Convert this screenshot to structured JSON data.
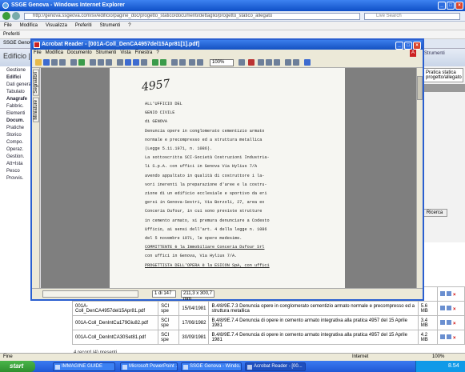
{
  "ie": {
    "title": "SSGE Genova - Windows Internet Explorer",
    "url": "http://genova.ssgeova.com/sv/edificio/pagine_doc/progetto_statico/documenti/dettaglio/progetto_statico_allegato",
    "search_placeholder": "Live Search",
    "menu": [
      "File",
      "Modifica",
      "Visualizza",
      "Preferiti",
      "Strumenti",
      "?"
    ],
    "favorites_label": "Preferiti",
    "tab_label": "SSGE Genova - Web Edificio..."
  },
  "app": {
    "header_title": "Edificio | sir",
    "right_header": "Strumenti",
    "right_lines": [
      "Pratica statica",
      "progetto/allegato"
    ],
    "right_button": "Ricerca",
    "sidebar": [
      {
        "label": "Gestione",
        "bold": false
      },
      {
        "label": "Edifici",
        "bold": true
      },
      {
        "label": "Dati generali",
        "bold": false
      },
      {
        "label": "Tabulato",
        "bold": false
      },
      {
        "label": "Anagrafe",
        "bold": true
      },
      {
        "label": "Fabbric.",
        "bold": false
      },
      {
        "label": "Elementi",
        "bold": false
      },
      {
        "label": "Docum.",
        "bold": true
      },
      {
        "label": "Pratiche",
        "bold": false
      },
      {
        "label": "Storico",
        "bold": false
      },
      {
        "label": "Compo.",
        "bold": false
      },
      {
        "label": "Operaz.",
        "bold": false
      },
      {
        "label": "Gestion.",
        "bold": false
      },
      {
        "label": "Att+Ista",
        "bold": false
      },
      {
        "label": "Pesco",
        "bold": false
      },
      {
        "label": "Provvis.",
        "bold": false
      }
    ],
    "table_rows": [
      {
        "file": "",
        "type": "",
        "date": "",
        "desc": "4957 del 15 Aprile 1981",
        "size": ""
      },
      {
        "file": "001A-Coll_DenCA4957del15Apr81.pdf",
        "type": "SCI spe",
        "date": "15/04/1981",
        "desc": "B.4/8/9E.7.3 Denuncia opere in conglomerato cementizio armato normale e precompresso ed a struttura metallica",
        "size": "5.6 MB"
      },
      {
        "file": "001A-Coll_DenIntCa179Giu82.pdf",
        "type": "SCI spe",
        "date": "17/06/1982",
        "desc": "B.4/8/9E.7.4 Denuncia di opere in cemento armato integrativa alla pratica 4957 del 15 Aprile 1981",
        "size": "3.4 MB"
      },
      {
        "file": "001A-Coll_DenIntCA30Set81.pdf",
        "type": "SCI spe",
        "date": "30/09/1981",
        "desc": "B.4/8/9E.7.4 Denuncia di opere in cemento armato integrativa alla pratica 4957 del 15 Aprile 1981",
        "size": "4.2 MB"
      }
    ],
    "table_footer": "4 record (4) presenti"
  },
  "acrobat": {
    "title": "Acrobat Reader - [001A-Coll_DenCA4957del15Apr81[1].pdf]",
    "menu": [
      "File",
      "Modifica",
      "Documento",
      "Strumenti",
      "Vista",
      "Finestra",
      "?"
    ],
    "zoom": "100%",
    "side_tabs": [
      "Segnalibri",
      "Miniature"
    ],
    "page_indicator": "1 di 147",
    "page_dims": "211,3 x 300,7 mm",
    "handwritten_number": "4957",
    "doc_lines": [
      {
        "t": "ALL'UFFICIO DEL",
        "u": false
      },
      {
        "t": "GENIO CIVILE",
        "u": false
      },
      {
        "t": "di GENOVA",
        "u": false
      },
      {
        "t": "Denuncia opere in conglomerato cementizio armato",
        "u": false
      },
      {
        "t": "normale e precompresso ed a struttura metallica",
        "u": false
      },
      {
        "t": "(Legge 5.11.1971, n. 1086).",
        "u": false
      },
      {
        "t": "La sottoscritta SCI-Società Costruzioni Industria-",
        "u": false
      },
      {
        "t": "li S.p.A. con uffici in Genova Via Hylius 7/A",
        "u": false
      },
      {
        "t": "avendo appaltato in qualità di costruttore i la-",
        "u": false
      },
      {
        "t": "vori inerenti la preparazione d'aree e la costru-",
        "u": false
      },
      {
        "t": "zione di un edificio ecclesiale e sportivo da eri",
        "u": false
      },
      {
        "t": "gersi in Genova-Sestri, Via Borzoli, 27, area ex",
        "u": false
      },
      {
        "t": "Conceria Dufour, in cui sono previste strutture",
        "u": false
      },
      {
        "t": "in cemento armato, si premura denunciare a Codesto",
        "u": false
      },
      {
        "t": "Ufficio, ai sensi dell'art. 4 della legge n. 1086",
        "u": false
      },
      {
        "t": "del 5 novembre 1971, le opere medesime.",
        "u": false
      },
      {
        "t": "COMMITTENTE è la Immobiliare Conceria Dufour Srl",
        "u": true
      },
      {
        "t": "con uffici in Genova, Via Hylius 7/A.",
        "u": false
      },
      {
        "t": "PROGETTISTA DELL'OPERA è la ESICON SpA, con uffici",
        "u": true
      }
    ]
  },
  "status": {
    "left": "Fine",
    "zone": "Internet",
    "zoom": "100%"
  },
  "taskbar": {
    "start": "start",
    "tasks": [
      "IMMAGINE GUIDE",
      "Microsoft PowerPoint ...",
      "SSGE Genova - Windo...",
      "Acrobat Reader - [00..."
    ],
    "clock": "8.54"
  }
}
